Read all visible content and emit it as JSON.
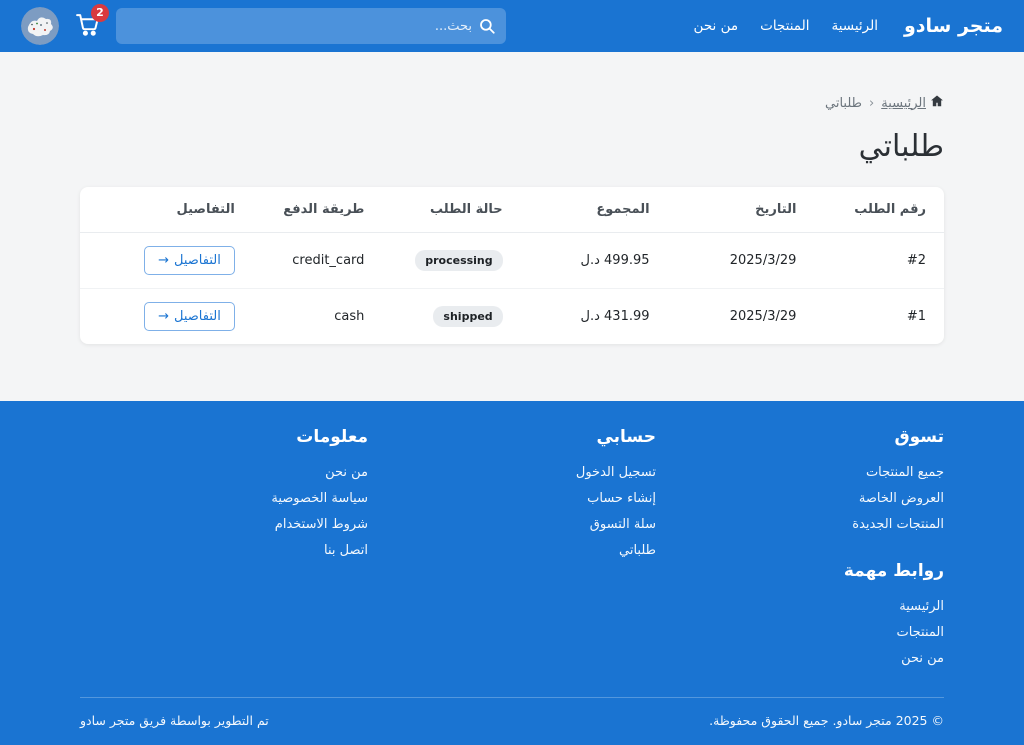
{
  "header": {
    "brand": "متجر سادو",
    "nav": [
      {
        "label": "الرئيسية"
      },
      {
        "label": "المنتجات"
      },
      {
        "label": "من نحن"
      }
    ],
    "search_placeholder": "بحث...",
    "cart_count": "2"
  },
  "breadcrumb": {
    "home": "الرئيسية",
    "separator": "‹",
    "current": "طلباتي"
  },
  "page": {
    "title": "طلباتي"
  },
  "orders_table": {
    "headers": {
      "number": "رقم الطلب",
      "date": "التاريخ",
      "total": "المجموع",
      "status": "حالة الطلب",
      "payment": "طريقة الدفع",
      "details": "التفاصيل"
    },
    "rows": [
      {
        "number": "#2",
        "date": "2025/3/29",
        "total": "499.95 د.ل",
        "status": "processing",
        "payment": "credit_card",
        "details_label": "التفاصيل",
        "details_arrow": "→"
      },
      {
        "number": "#1",
        "date": "2025/3/29",
        "total": "431.99 د.ل",
        "status": "shipped",
        "payment": "cash",
        "details_label": "التفاصيل",
        "details_arrow": "→"
      }
    ]
  },
  "footer": {
    "columns": [
      {
        "title": "تسوق",
        "links": [
          "جميع المنتجات",
          "العروض الخاصة",
          "المنتجات الجديدة"
        ]
      },
      {
        "title": "حسابي",
        "links": [
          "تسجيل الدخول",
          "إنشاء حساب",
          "سلة التسوق",
          "طلباتي"
        ]
      },
      {
        "title": "معلومات",
        "links": [
          "من نحن",
          "سياسة الخصوصية",
          "شروط الاستخدام",
          "اتصل بنا"
        ]
      }
    ],
    "important": {
      "title": "روابط مهمة",
      "links": [
        "الرئيسية",
        "المنتجات",
        "من نحن"
      ]
    },
    "copyright": "© 2025 متجر سادو. جميع الحقوق محفوظة.",
    "developed_by": "تم التطوير بواسطة فريق متجر سادو"
  },
  "colors": {
    "primary": "#1a74d2",
    "badge_bg": "#e9ecef",
    "cart_badge": "#d93a3f",
    "page_bg": "#f4f5f6"
  }
}
